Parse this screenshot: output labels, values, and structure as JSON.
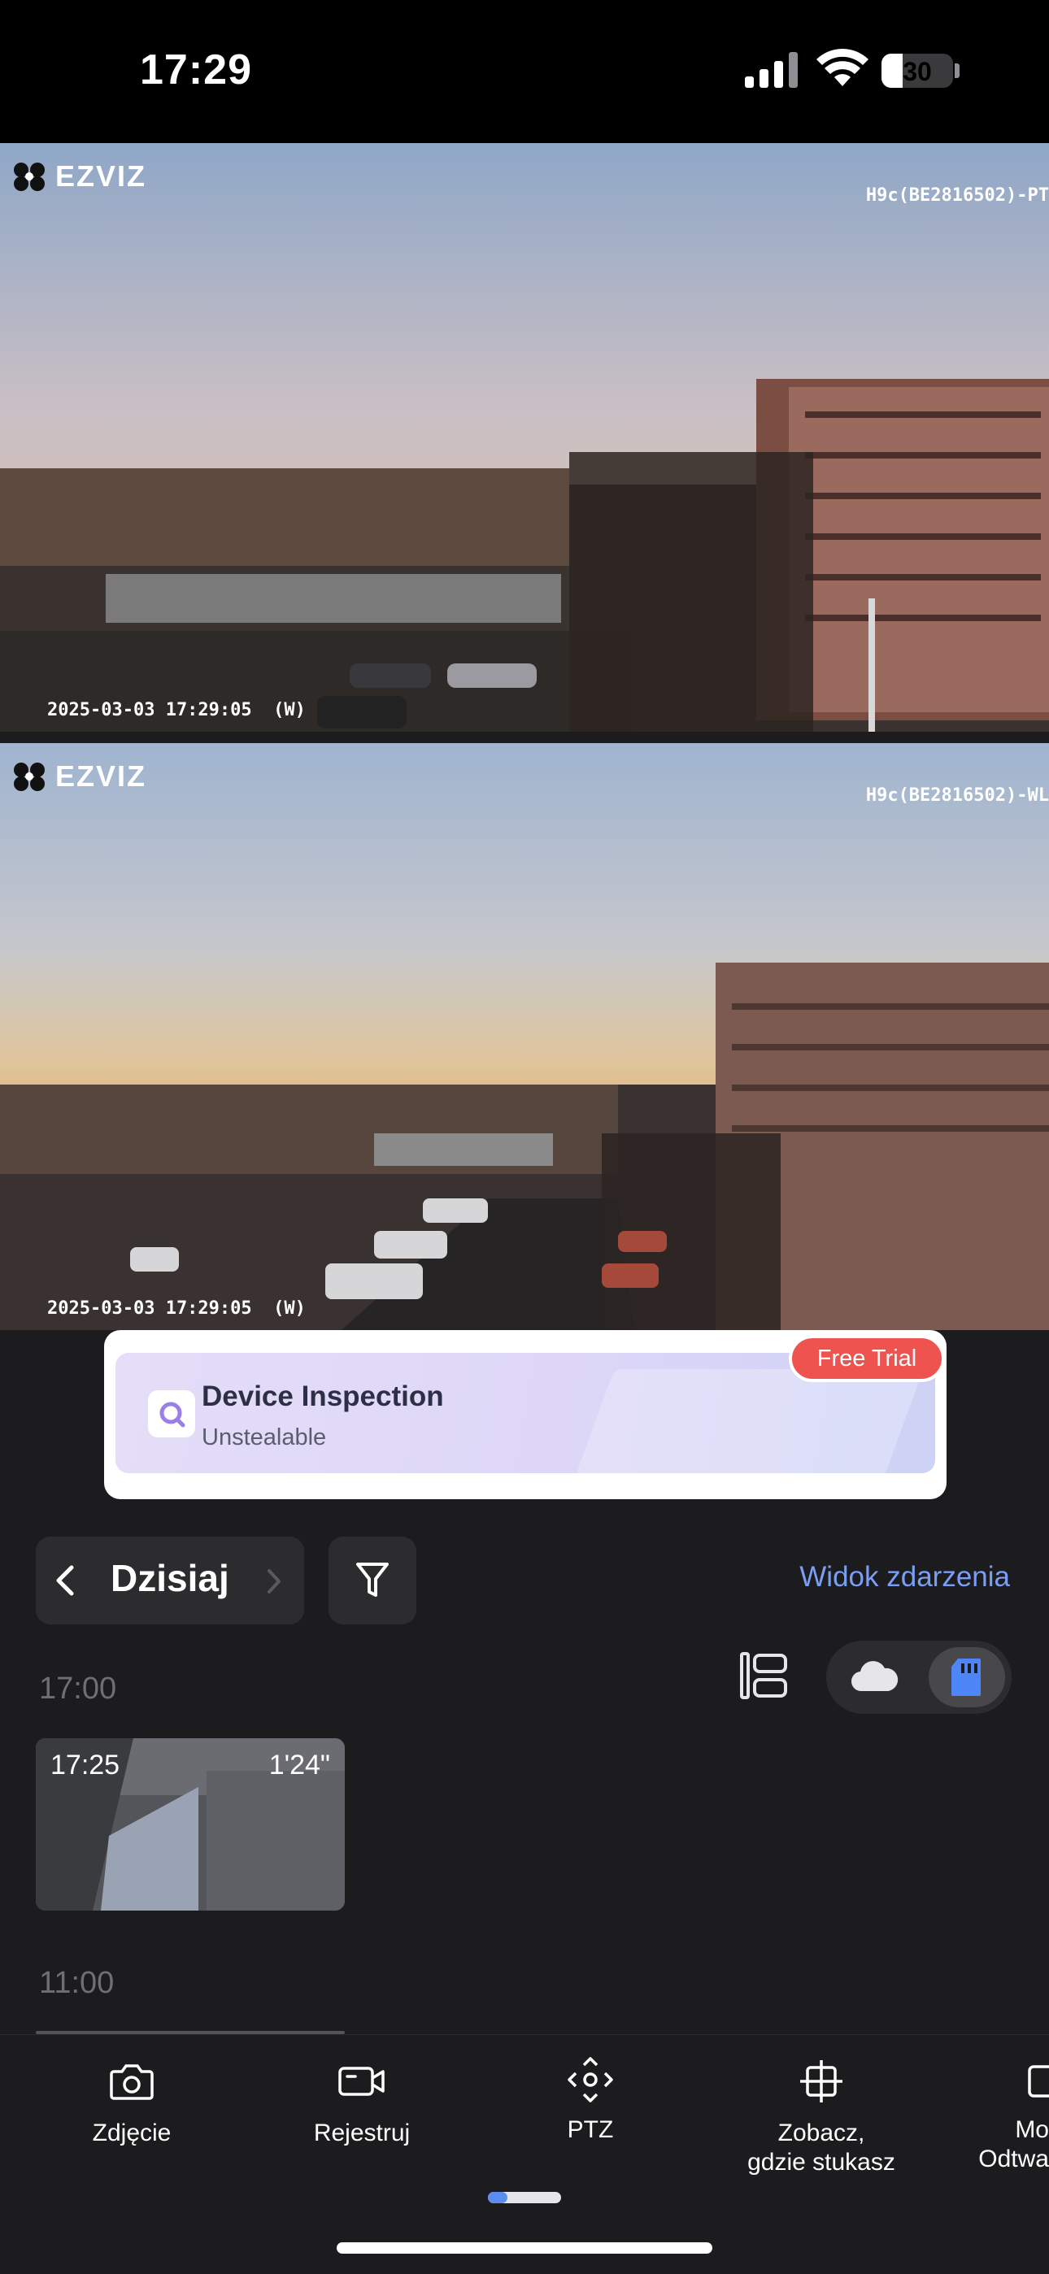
{
  "status_bar": {
    "time": "17:29",
    "battery_percent": "30",
    "battery_level": 0.3
  },
  "feeds": [
    {
      "brand": "EZVIZ",
      "camera_name": "H9c(BE2816502)-PT",
      "timestamp": "2025-03-03 17:29:05  (W)"
    },
    {
      "brand": "EZVIZ",
      "camera_name": "H9c(BE2816502)-WL",
      "timestamp": "2025-03-03 17:29:05  (W)"
    }
  ],
  "promo": {
    "title": "Device Inspection",
    "subtitle": "Unstealable",
    "badge": "Free Trial"
  },
  "timeline": {
    "date_label": "Dzisiaj",
    "event_view_link": "Widok zdarzenia",
    "groups": [
      "17:00",
      "11:00"
    ],
    "clip": {
      "start": "17:25",
      "duration": "1'24\""
    }
  },
  "toolbar": {
    "items": [
      {
        "label": "Zdjęcie",
        "icon": "camera-icon"
      },
      {
        "label": "Rejestruj",
        "icon": "video-record-icon"
      },
      {
        "label": "PTZ",
        "icon": "ptz-icon"
      },
      {
        "label": "Zobacz,\ngdzie stukasz",
        "icon": "crosshair-icon"
      },
      {
        "label": "Mo\nOdtwa",
        "icon": "playback-icon"
      }
    ]
  },
  "colors": {
    "accent": "#7b9ef5",
    "badge": "#ef5350",
    "background": "#1c1c1e"
  }
}
